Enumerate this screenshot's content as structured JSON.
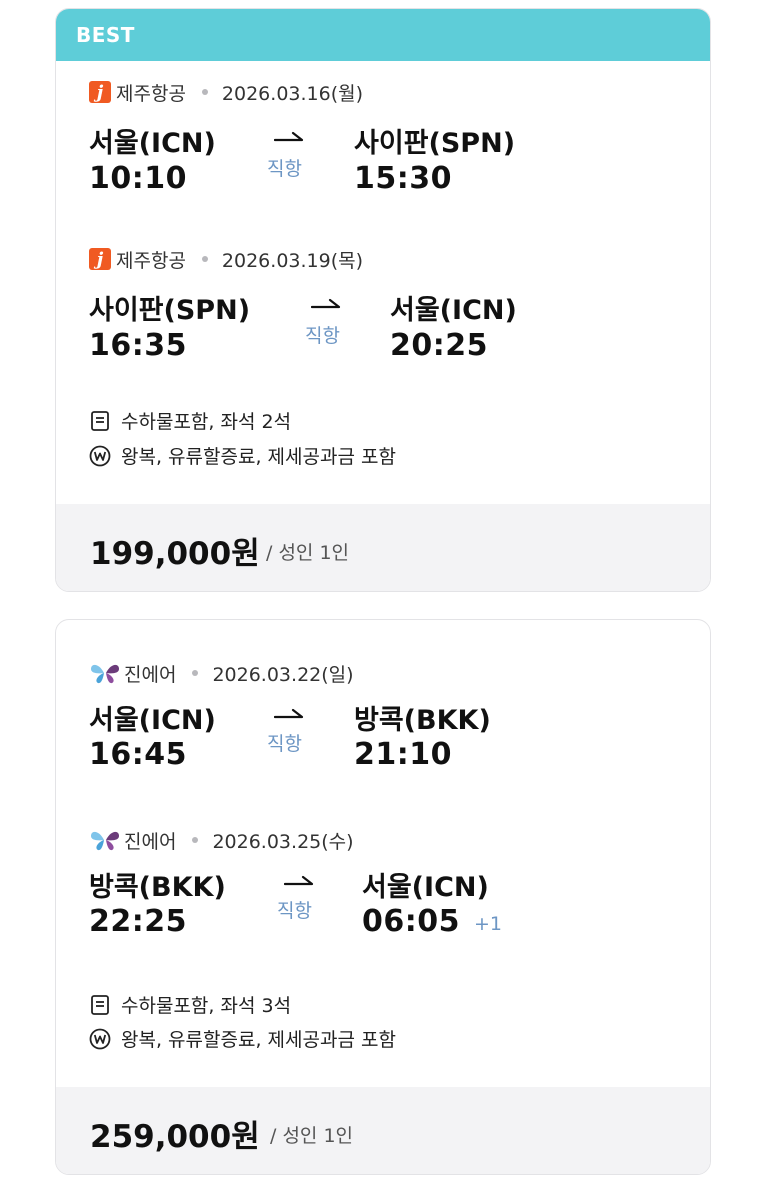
{
  "offers": [
    {
      "badge": "BEST",
      "legs": [
        {
          "airline": "제주항공",
          "airline_icon": "jejuair-logo-icon",
          "date": "2026.03.16(월)",
          "from_city": "서울(ICN)",
          "to_city": "사이판(SPN)",
          "depart_time": "10:10",
          "arrive_time": "15:30",
          "direct": "직항"
        },
        {
          "airline": "제주항공",
          "airline_icon": "jejuair-logo-icon",
          "date": "2026.03.19(목)",
          "from_city": "사이판(SPN)",
          "to_city": "서울(ICN)",
          "depart_time": "16:35",
          "arrive_time": "20:25",
          "direct": "직항"
        }
      ],
      "baggage_seats": "수하물포함, 좌석 2석",
      "fare_note": "왕복, 유류할증료, 제세공과금 포함",
      "price": "199,000원",
      "per_person": "/ 성인 1인"
    },
    {
      "legs": [
        {
          "airline": "진에어",
          "airline_icon": "jinair-logo-icon",
          "date": "2026.03.22(일)",
          "from_city": "서울(ICN)",
          "to_city": "방콕(BKK)",
          "depart_time": "16:45",
          "arrive_time": "21:10",
          "direct": "직항"
        },
        {
          "airline": "진에어",
          "airline_icon": "jinair-logo-icon",
          "date": "2026.03.25(수)",
          "from_city": "방콕(BKK)",
          "to_city": "서울(ICN)",
          "depart_time": "22:25",
          "arrive_time": "06:05",
          "next_day": "+1",
          "direct": "직항"
        }
      ],
      "baggage_seats": "수하물포함, 좌석 3석",
      "fare_note": "왕복, 유류할증료, 제세공과금 포함",
      "price": "259,000원",
      "per_person": "/ 성인 1인"
    }
  ],
  "colors": {
    "best_banner": "#5ecdd8",
    "direct_text": "#6d96c4",
    "jejuair_brand": "#f05a22",
    "price_bar_bg": "#f3f3f5"
  }
}
